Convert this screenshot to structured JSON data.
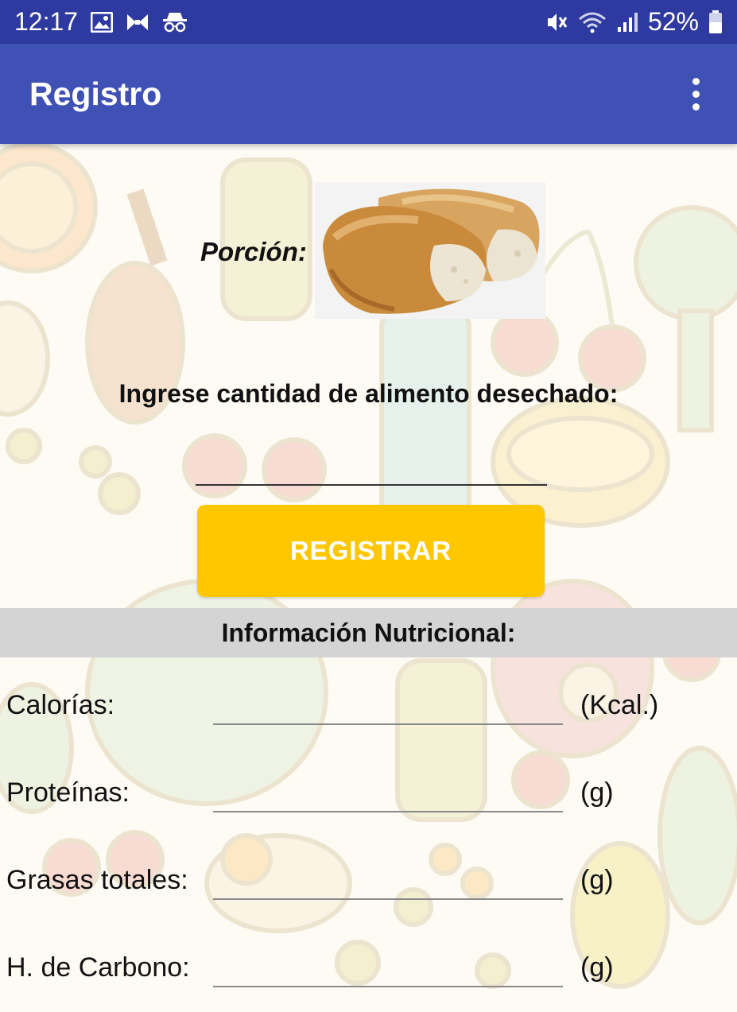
{
  "status_bar": {
    "time": "12:17",
    "battery": "52%",
    "left_icons": [
      "image-icon",
      "bowtie-icon",
      "incognito-icon"
    ],
    "right_icons": [
      "mute-vibrate-icon",
      "wifi-icon",
      "signal-icon",
      "battery-icon"
    ]
  },
  "app_bar": {
    "title": "Registro",
    "menu_icon": "more-vert-icon",
    "color": "#3f51b5"
  },
  "form": {
    "portion_label": "Porción:",
    "portion_image": "bread-image",
    "quantity_prompt": "Ingrese cantidad de alimento desechado:",
    "quantity_value": "",
    "register_label": "REGISTRAR",
    "register_color": "#ffc700"
  },
  "nutrition": {
    "header": "Información Nutricional:",
    "rows": [
      {
        "label": "Calorías:",
        "value": "",
        "unit": "(Kcal.)"
      },
      {
        "label": "Proteínas:",
        "value": "",
        "unit": "(g)"
      },
      {
        "label": "Grasas totales:",
        "value": "",
        "unit": "(g)"
      },
      {
        "label": "H. de Carbono:",
        "value": "",
        "unit": "(g)"
      }
    ]
  }
}
